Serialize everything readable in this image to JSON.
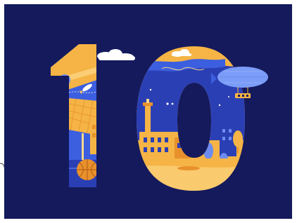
{
  "illustration": {
    "subject": "10",
    "colors": {
      "background": "#141a5c",
      "sky_blue": "#3c5fe0",
      "deep_blue": "#2b3fb5",
      "light_blue": "#6d8cf0",
      "orange": "#f5b445",
      "deep_orange": "#e8912c",
      "pale_yellow": "#fdd98a",
      "cloud": "#ffffff",
      "zeppelin": "#7b9cf7"
    }
  }
}
